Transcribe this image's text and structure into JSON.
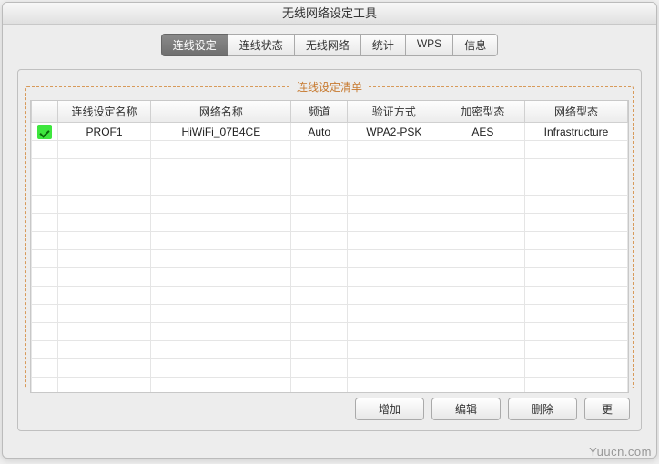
{
  "window": {
    "title": "无线网络设定工具"
  },
  "tabs": {
    "items": [
      {
        "label": "连线设定",
        "active": true
      },
      {
        "label": "连线状态",
        "active": false
      },
      {
        "label": "无线网络",
        "active": false
      },
      {
        "label": "统计",
        "active": false
      },
      {
        "label": "WPS",
        "active": false
      },
      {
        "label": "信息",
        "active": false
      }
    ]
  },
  "profileList": {
    "legend": "连线设定清单",
    "columns": {
      "check": "",
      "profile": "连线设定名称",
      "ssid": "网络名称",
      "channel": "频道",
      "auth": "验证方式",
      "enc": "加密型态",
      "net": "网络型态"
    },
    "rows": [
      {
        "active": true,
        "profile": "PROF1",
        "ssid": "HiWiFi_07B4CE",
        "channel": "Auto",
        "auth": "WPA2-PSK",
        "enc": "AES",
        "net": "Infrastructure"
      }
    ],
    "emptyRows": 14
  },
  "buttons": {
    "add": "增加",
    "edit": "编辑",
    "delete": "删除",
    "more": "更"
  },
  "watermark": "Yuucn.com"
}
